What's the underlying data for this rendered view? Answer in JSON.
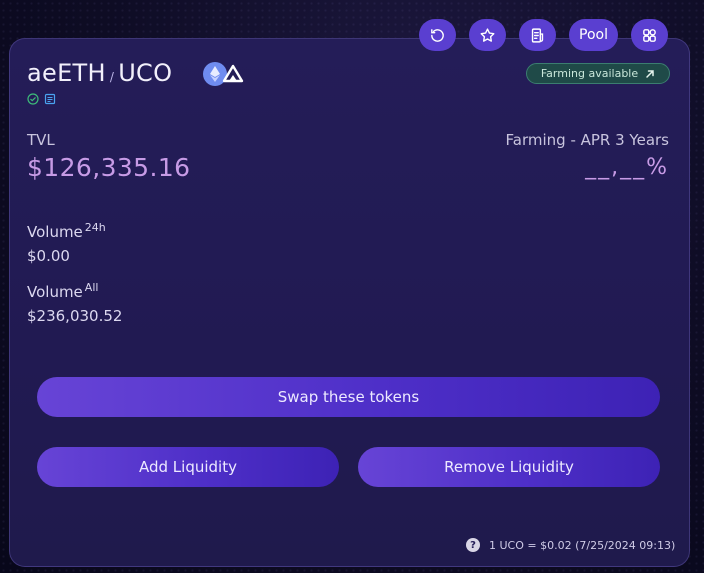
{
  "pair": {
    "token_a": "aeETH",
    "separator": "/",
    "token_b": "UCO"
  },
  "toolbar": {
    "pool_label": "Pool"
  },
  "farming_badge": {
    "label": "Farming available"
  },
  "tvl": {
    "label": "TVL",
    "value": "$126,335.16"
  },
  "apr": {
    "label": "Farming - APR 3 Years",
    "value": "__,__%"
  },
  "volume_24h": {
    "label": "Volume",
    "suffix": "24h",
    "value": "$0.00"
  },
  "volume_all": {
    "label": "Volume",
    "suffix": "All",
    "value": "$236,030.52"
  },
  "buttons": {
    "swap": "Swap these tokens",
    "add_liquidity": "Add Liquidity",
    "remove_liquidity": "Remove Liquidity"
  },
  "footer": {
    "help": "?",
    "rate": "1 UCO = $0.02 (7/25/2024 09:13)"
  },
  "icons": [
    "refresh-icon",
    "star-icon",
    "document-icon",
    "apps-icon",
    "ethereum-icon",
    "archethic-icon",
    "verified-icon",
    "contract-icon",
    "arrow-up-right-icon",
    "help-icon"
  ],
  "colors": {
    "accent": "#5a3fd0",
    "value_purple": "#c79be6",
    "badge_bg": "#1f4a48"
  }
}
